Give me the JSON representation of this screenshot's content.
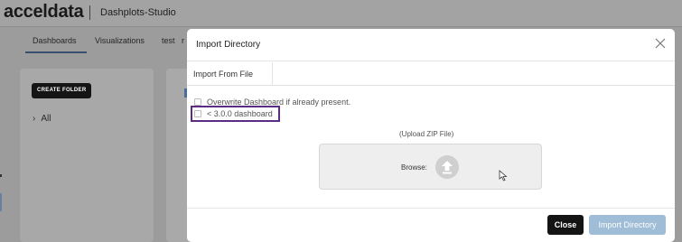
{
  "app": {
    "logo_text": "acceldata",
    "title": "Dashplots-Studio",
    "tabs": [
      "Dashboards",
      "Visualizations",
      "test",
      "r"
    ],
    "sidebar": {
      "create_folder_label": "CREATE FOLDER",
      "tree_root_label": "All"
    }
  },
  "modal": {
    "title": "Import Directory",
    "tab_label": "Import From File",
    "options": [
      {
        "label": "Overwrite Dashboard if already present.",
        "checked": false
      },
      {
        "label": "< 3.0.0 dashboard",
        "checked": false
      }
    ],
    "upload_label": "(Upload ZIP File)",
    "browse_label": "Browse:",
    "buttons": {
      "close_label": "Close",
      "import_label": "Import Directory"
    }
  },
  "colors": {
    "highlight_border": "#5a2d82",
    "import_button_bg": "#9fbdd6",
    "close_button_bg": "#141414"
  },
  "icons": {
    "close": "close-icon",
    "upload": "upload-icon",
    "chevron": "chevron-right-icon",
    "cursor": "mouse-cursor-icon"
  }
}
